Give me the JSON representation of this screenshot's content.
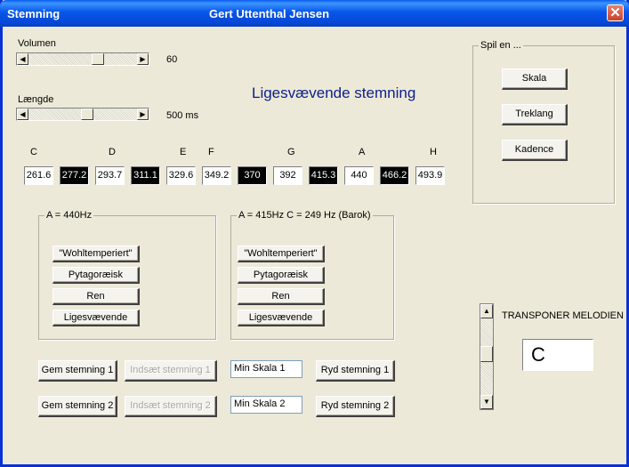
{
  "window": {
    "title": "Stemning",
    "author": "Gert Uttenthal Jensen",
    "close_glyph": "✕"
  },
  "volumen": {
    "label": "Volumen",
    "value_text": "60"
  },
  "laengde": {
    "label": "Længde",
    "value_text": "500 ms"
  },
  "heading": "Ligesvævende stemning",
  "spil": {
    "legend": "Spil en ...",
    "buttons": [
      "Skala",
      "Treklang",
      "Kadence"
    ]
  },
  "note_labels": [
    "C",
    "D",
    "E",
    "F",
    "G",
    "A",
    "H"
  ],
  "note_values": [
    "261.6",
    "277.2",
    "293.7",
    "311.1",
    "329.6",
    "349.2",
    "370",
    "392",
    "415.3",
    "440",
    "466.2",
    "493.9"
  ],
  "group_a": {
    "legend": "A = 440Hz",
    "buttons": [
      "\"Wohltemperiert\"",
      "Pytagoræisk",
      "Ren",
      "Ligesvævende"
    ]
  },
  "group_b": {
    "legend": "A = 415Hz C = 249 Hz (Barok)",
    "buttons": [
      "\"Wohltemperiert\"",
      "Pytagoræisk",
      "Ren",
      "Ligesvævende"
    ]
  },
  "rows": [
    {
      "save": "Gem stemning 1",
      "insert": "Indsæt stemning 1",
      "name": "Min Skala 1",
      "clear": "Ryd stemning 1"
    },
    {
      "save": "Gem stemning 2",
      "insert": "Indsæt stemning 2",
      "name": "Min Skala 2",
      "clear": "Ryd stemning 2"
    }
  ],
  "transpose": {
    "label": "TRANSPONER MELODIEN",
    "value": "C"
  },
  "colors": {
    "title_blue": "#0c1f8c",
    "black_key": "#000000",
    "white_key": "#ffffff"
  }
}
